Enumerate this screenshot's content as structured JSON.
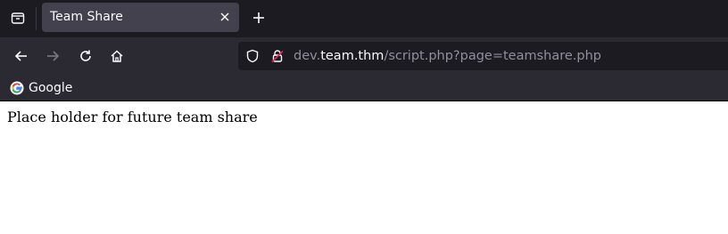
{
  "browser": {
    "tab": {
      "title": "Team Share"
    },
    "url": {
      "prefix": "dev.",
      "domain": "team.thm",
      "path": "/script.php?page=teamshare.php"
    },
    "bookmarks": [
      {
        "label": "Google"
      }
    ]
  },
  "page": {
    "text": "Place holder for future team share"
  },
  "colors": {
    "chrome": "#2b2a33",
    "tabbar": "#1c1b22",
    "active_tab": "#42414d",
    "text_light": "#fbfbfe",
    "url_muted": "#8f8f9d"
  }
}
